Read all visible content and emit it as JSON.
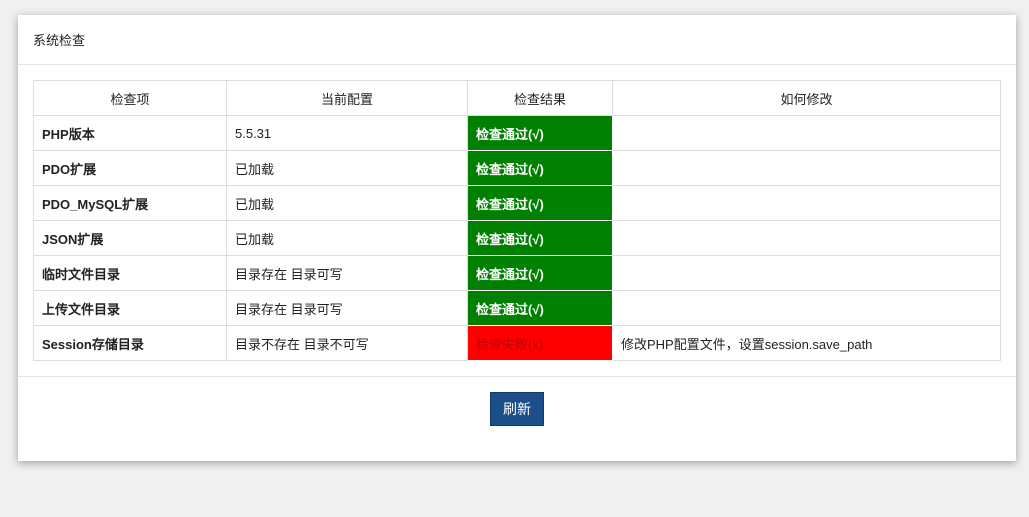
{
  "panel": {
    "title": "系统检查"
  },
  "table": {
    "headers": [
      "检查项",
      "当前配置",
      "检查结果",
      "如何修改"
    ],
    "rows": [
      {
        "item": "PHP版本",
        "config": "5.5.31",
        "result": "检查通过(√)",
        "status": "ok",
        "fix": ""
      },
      {
        "item": "PDO扩展",
        "config": "已加载",
        "result": "检查通过(√)",
        "status": "ok",
        "fix": ""
      },
      {
        "item": "PDO_MySQL扩展",
        "config": "已加载",
        "result": "检查通过(√)",
        "status": "ok",
        "fix": ""
      },
      {
        "item": "JSON扩展",
        "config": "已加载",
        "result": "检查通过(√)",
        "status": "ok",
        "fix": ""
      },
      {
        "item": "临时文件目录",
        "config": "目录存在 目录可写",
        "result": "检查通过(√)",
        "status": "ok",
        "fix": ""
      },
      {
        "item": "上传文件目录",
        "config": "目录存在 目录可写",
        "result": "检查通过(√)",
        "status": "ok",
        "fix": ""
      },
      {
        "item": "Session存储目录",
        "config": "目录不存在 目录不可写",
        "result": "检查失败(x)",
        "status": "bad",
        "fix": "修改PHP配置文件，设置session.save_path"
      }
    ]
  },
  "footer": {
    "refresh_label": "刷新"
  },
  "colors": {
    "ok": "#008000",
    "bad": "#ff0000",
    "button": "#1b4f8a"
  }
}
